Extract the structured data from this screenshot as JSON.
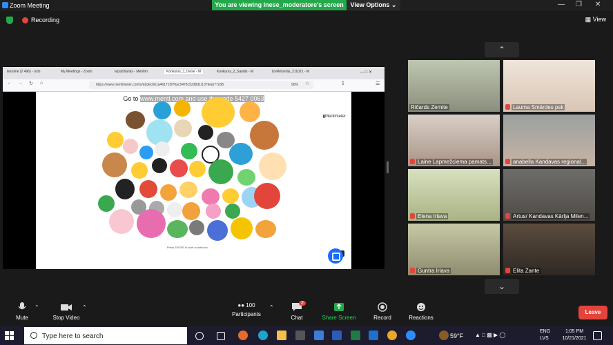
{
  "window": {
    "title": "Zoom Meeting"
  },
  "banner": {
    "viewing_text": "You are viewing Inese_moderatore's screen",
    "view_options": "View Options"
  },
  "topbar": {
    "recording": "Recording",
    "view": "View"
  },
  "browser": {
    "tabs": [
      "Iesošne (2 496) - ozlo",
      "My Meetings - Zoom",
      "Iepazīšanās - Mentim",
      "Konkurss_1_Inese - M",
      "Konkurss_2_Sandis - M",
      "Izvēlēšanās_211021 - M"
    ],
    "url": "https://www.mentimeter.com/s/d2dec6b1a46171f970ac5478c5238d1/137feab77c88",
    "zoom": "90%"
  },
  "slide": {
    "goto_prefix": "Go to",
    "goto_url": "www.menti.com and use the code 5427 0063",
    "logo": "Mentimeter",
    "enter_hint": "Press ENTER to start countdown"
  },
  "participants": [
    {
      "name": "Ričards Zemite",
      "muted": false
    },
    {
      "name": "Lauma Smārdes psk",
      "muted": true
    },
    {
      "name": "Laine Lapmežciema pamats...",
      "muted": true
    },
    {
      "name": "anabella Kandavas regional...",
      "muted": true
    },
    {
      "name": "Elena Irlava",
      "muted": true
    },
    {
      "name": "Artus/ Kandavas Kārlja Milen...",
      "muted": true
    },
    {
      "name": "Guntra Irlava",
      "muted": true
    },
    {
      "name": "Elita Zante",
      "muted": true
    }
  ],
  "toolbar": {
    "mute": "Mute",
    "stop_video": "Stop Video",
    "participants": "Participants",
    "participant_count": "100",
    "chat": "Chat",
    "chat_badge": "2",
    "share_screen": "Share Screen",
    "record": "Record",
    "reactions": "Reactions",
    "leave": "Leave"
  },
  "taskbar": {
    "search_placeholder": "Type here to search",
    "weather": "59°F",
    "lang_1": "ENG",
    "lang_2": "LVS",
    "time": "1:05 PM",
    "date": "10/21/2021"
  },
  "colors": {
    "accent": "#2d8cff",
    "share_green": "#23a94a",
    "leave_red": "#e5443c"
  }
}
